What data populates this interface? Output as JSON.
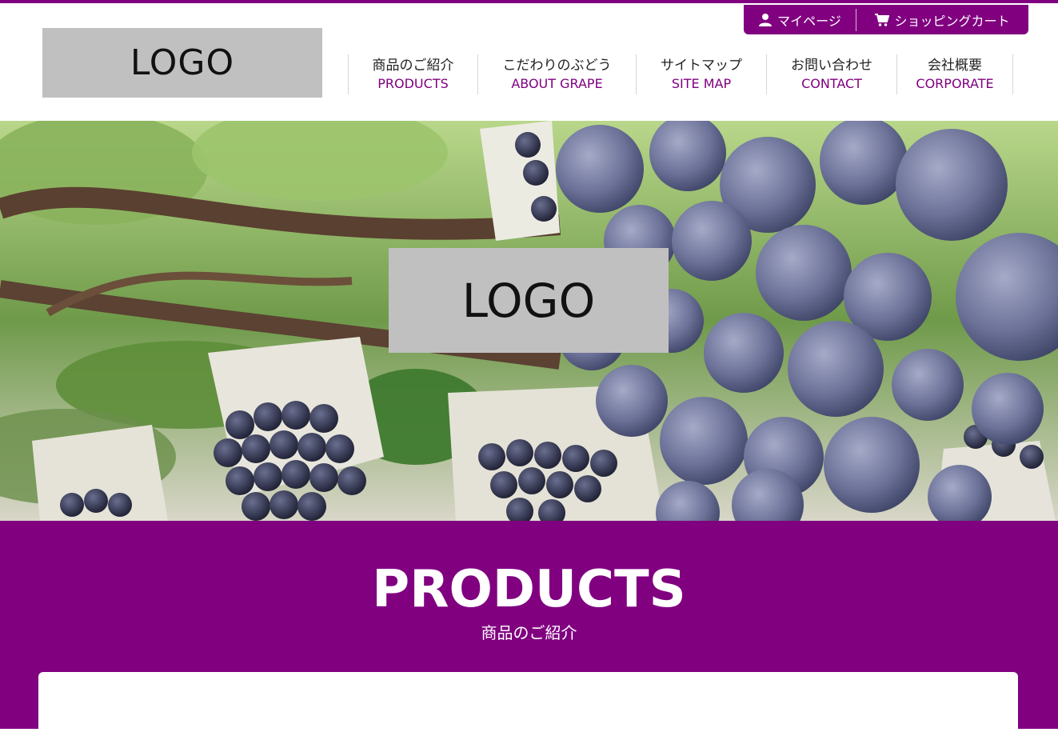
{
  "header": {
    "logo_text": "LOGO",
    "utility": {
      "mypage_label": "マイページ",
      "mypage_icon": "user-icon",
      "cart_label": "ショッピングカート",
      "cart_icon": "shopping-cart-icon"
    },
    "nav": [
      {
        "jp": "商品のご紹介",
        "en": "PRODUCTS"
      },
      {
        "jp": "こだわりのぶどう",
        "en": "ABOUT GRAPE"
      },
      {
        "jp": "サイトマップ",
        "en": "SITE MAP"
      },
      {
        "jp": "お問い合わせ",
        "en": "CONTACT"
      },
      {
        "jp": "会社概要",
        "en": "CORPORATE"
      }
    ]
  },
  "hero": {
    "logo_text": "LOGO"
  },
  "products": {
    "title": "PRODUCTS",
    "subtitle": "商品のご紹介"
  },
  "colors": {
    "brand": "#800080",
    "logo_placeholder": "#c0c0c0",
    "nav_text": "#222222",
    "white": "#ffffff"
  }
}
